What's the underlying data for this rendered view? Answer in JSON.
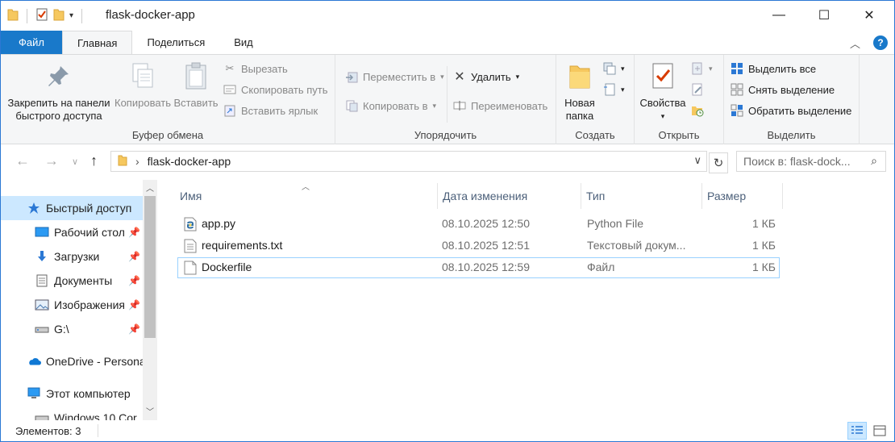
{
  "window": {
    "title": "flask-docker-app"
  },
  "title_buttons": {
    "minimize": "—",
    "maximize": "☐",
    "close": "✕"
  },
  "tabs": [
    {
      "label": "Файл",
      "kind": "file"
    },
    {
      "label": "Главная",
      "kind": "active"
    },
    {
      "label": "Поделиться",
      "kind": "normal"
    },
    {
      "label": "Вид",
      "kind": "normal"
    }
  ],
  "ribbon": {
    "clipboard": {
      "label": "Буфер обмена",
      "pin": "Закрепить на панели быстрого доступа",
      "pin_line1": "Закрепить на панели",
      "pin_line2": "быстрого доступа",
      "copy": "Копировать",
      "paste": "Вставить",
      "cut": "Вырезать",
      "copy_path": "Скопировать путь",
      "paste_shortcut": "Вставить ярлык"
    },
    "organize": {
      "label": "Упорядочить",
      "move_to": "Переместить в",
      "copy_to": "Копировать в",
      "delete": "Удалить",
      "rename": "Переименовать"
    },
    "new": {
      "label": "Создать",
      "new_folder_line1": "Новая",
      "new_folder_line2": "папка"
    },
    "open": {
      "label": "Открыть",
      "properties": "Свойства"
    },
    "select": {
      "label": "Выделить",
      "select_all": "Выделить все",
      "select_none": "Снять выделение",
      "invert": "Обратить выделение"
    }
  },
  "address": {
    "path": "flask-docker-app"
  },
  "search": {
    "placeholder": "Поиск в: flask-dock..."
  },
  "nav": {
    "items": [
      {
        "label": "Быстрый доступ",
        "icon": "star-icon",
        "pinned": false,
        "selected": true
      },
      {
        "label": "Рабочий стол",
        "icon": "desktop-icon",
        "pinned": true,
        "selected": false
      },
      {
        "label": "Загрузки",
        "icon": "download-icon",
        "pinned": true,
        "selected": false
      },
      {
        "label": "Документы",
        "icon": "documents-icon",
        "pinned": true,
        "selected": false
      },
      {
        "label": "Изображения",
        "icon": "pictures-icon",
        "pinned": true,
        "selected": false
      },
      {
        "label": "G:\\",
        "icon": "drive-icon",
        "pinned": true,
        "selected": false
      },
      {
        "label": "OneDrive - Personal",
        "icon": "onedrive-icon",
        "pinned": false,
        "selected": false
      },
      {
        "label": "Этот компьютер",
        "icon": "computer-icon",
        "pinned": false,
        "selected": false
      },
      {
        "label": "Windows 10 Cor",
        "icon": "drive-icon",
        "pinned": false,
        "selected": false
      }
    ]
  },
  "columns": {
    "name": "Имя",
    "date": "Дата изменения",
    "type": "Тип",
    "size": "Размер"
  },
  "files": [
    {
      "name": "app.py",
      "date": "08.10.2025 12:50",
      "type": "Python File",
      "size": "1 КБ",
      "icon": "python-file-icon"
    },
    {
      "name": "requirements.txt",
      "date": "08.10.2025 12:51",
      "type": "Текстовый докум...",
      "size": "1 КБ",
      "icon": "text-file-icon"
    },
    {
      "name": "Dockerfile",
      "date": "08.10.2025 12:59",
      "type": "Файл",
      "size": "1 КБ",
      "icon": "blank-file-icon"
    }
  ],
  "status": {
    "items": "Элементов: 3"
  },
  "colors": {
    "accent": "#1979ca",
    "selection": "#cce8ff",
    "folder": "#f6c85f"
  }
}
